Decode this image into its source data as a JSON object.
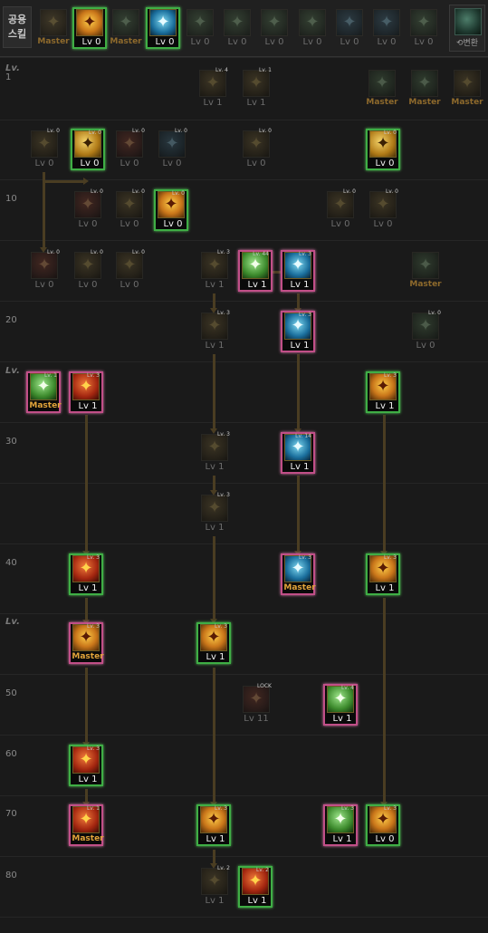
{
  "top_bar": {
    "share_tab_label_1": "공용",
    "share_tab_label_2": "스킬",
    "convert_label": "⟲변환",
    "slots": [
      {
        "name": "crab-claw-icon",
        "label": "Master",
        "state": "dim",
        "theme": "i-dark"
      },
      {
        "name": "gold-flame-icon",
        "label": "Lv 0",
        "state": "active",
        "theme": "i-gold2"
      },
      {
        "name": "wolf-head-icon",
        "label": "Master",
        "state": "dim",
        "theme": "i-darkg"
      },
      {
        "name": "blue-wings-icon",
        "label": "Lv 0",
        "state": "active",
        "theme": "i-blue"
      },
      {
        "name": "green-swirl-icon",
        "label": "Lv 0",
        "state": "dim",
        "theme": "i-darkg"
      },
      {
        "name": "target-icon",
        "label": "Lv 0",
        "state": "dim",
        "theme": "i-darkg"
      },
      {
        "name": "crouching-figure-icon",
        "label": "Lv 0",
        "state": "dim",
        "theme": "i-darkg"
      },
      {
        "name": "dragon-head-icon",
        "label": "Lv 0",
        "state": "dim",
        "theme": "i-darkg"
      },
      {
        "name": "spiral-icon",
        "label": "Lv 0",
        "state": "dim",
        "theme": "i-darkb"
      },
      {
        "name": "armored-figure-icon",
        "label": "Lv 0",
        "state": "dim",
        "theme": "i-darkb"
      },
      {
        "name": "warrior-figure-icon",
        "label": "Lv 0",
        "state": "dim",
        "theme": "i-darkg"
      }
    ]
  },
  "level_labels": [
    {
      "text": "Lv.",
      "kind": "hdr"
    },
    {
      "text": "1",
      "kind": "n"
    },
    {
      "text": "10",
      "kind": "n"
    },
    {
      "text": "20",
      "kind": "n"
    },
    {
      "text": "Lv.",
      "kind": "hdr"
    },
    {
      "text": "30",
      "kind": "n"
    },
    {
      "text": "40",
      "kind": "n"
    },
    {
      "text": "Lv.",
      "kind": "hdr"
    },
    {
      "text": "50",
      "kind": "n"
    },
    {
      "text": "60",
      "kind": "n"
    },
    {
      "text": "70",
      "kind": "n"
    },
    {
      "text": "80",
      "kind": "n"
    }
  ],
  "skills": [
    {
      "id": "shuriken-dash",
      "label": "Lv 1",
      "state": "dim",
      "theme": "i-dark",
      "small": "Lv. 4"
    },
    {
      "id": "axe-strike",
      "label": "Lv 1",
      "state": "dim",
      "theme": "i-dark",
      "small": "Lv. 1"
    },
    {
      "id": "stance-master-a",
      "label": "Master",
      "state": "dim",
      "theme": "i-darkg",
      "small": ""
    },
    {
      "id": "stance-master-b",
      "label": "Master",
      "state": "dim",
      "theme": "i-darkg",
      "small": ""
    },
    {
      "id": "stance-master-c",
      "label": "Master",
      "state": "dim",
      "theme": "i-dark",
      "small": ""
    },
    {
      "id": "fish-throw",
      "label": "Lv 0",
      "state": "dim",
      "theme": "i-dark",
      "small": "Lv. 0"
    },
    {
      "id": "golden-burst",
      "label": "Lv 0",
      "state": "active",
      "theme": "i-gold",
      "small": "Lv. 0"
    },
    {
      "id": "pentagram",
      "label": "Lv 0",
      "state": "dim",
      "theme": "i-darkr",
      "small": "Lv. 0"
    },
    {
      "id": "knot-seal",
      "label": "Lv 0",
      "state": "dim",
      "theme": "i-darkb",
      "small": "Lv. 0"
    },
    {
      "id": "whip-lash",
      "label": "Lv 0",
      "state": "dim",
      "theme": "i-dark",
      "small": "Lv. 0"
    },
    {
      "id": "rising-kick",
      "label": "Lv 0",
      "state": "active",
      "theme": "i-gold",
      "small": "Lv. 0"
    },
    {
      "id": "red-charm",
      "label": "Lv 0",
      "state": "dim",
      "theme": "i-darkr",
      "small": "Lv. 0"
    },
    {
      "id": "flame-wave",
      "label": "Lv 0",
      "state": "dim",
      "theme": "i-dark",
      "small": "Lv. 0"
    },
    {
      "id": "gold-aura",
      "label": "Lv 0",
      "state": "active",
      "theme": "i-gold2",
      "small": "Lv. 0"
    },
    {
      "id": "twin-blades",
      "label": "Lv 0",
      "state": "dim",
      "theme": "i-dark",
      "small": "Lv. 0"
    },
    {
      "id": "sweeping-kick",
      "label": "Lv 0",
      "state": "dim",
      "theme": "i-dark",
      "small": "Lv. 0"
    },
    {
      "id": "crimson-slash",
      "label": "Lv 0",
      "state": "dim",
      "theme": "i-darkr",
      "small": "Lv. 0"
    },
    {
      "id": "spider-burst",
      "label": "Lv 0",
      "state": "dim",
      "theme": "i-dark",
      "small": "Lv. 0"
    },
    {
      "id": "fire-pillar",
      "label": "Lv 0",
      "state": "dim",
      "theme": "i-dark",
      "small": "Lv. 0"
    },
    {
      "id": "wind-cut",
      "label": "Lv 1",
      "state": "dim",
      "theme": "i-dark",
      "small": "Lv. 3"
    },
    {
      "id": "green-leap",
      "label": "Lv 1",
      "state": "pink",
      "theme": "i-green",
      "small": "Lv. 44"
    },
    {
      "id": "water-blade",
      "label": "Lv 1",
      "state": "pink",
      "theme": "i-blue",
      "small": "Lv. 3"
    },
    {
      "id": "forest-master",
      "label": "Master",
      "state": "dim",
      "theme": "i-darkg",
      "small": ""
    },
    {
      "id": "heat-ray",
      "label": "Lv 1",
      "state": "dim",
      "theme": "i-dark",
      "small": "Lv. 3"
    },
    {
      "id": "heart-shield",
      "label": "Lv 1",
      "state": "pink",
      "theme": "i-blue",
      "small": "Lv. 3"
    },
    {
      "id": "shadow-step",
      "label": "Lv 0",
      "state": "dim",
      "theme": "i-darkg",
      "small": "Lv. 0"
    },
    {
      "id": "spirit-call",
      "label": "Master",
      "state": "pink",
      "theme": "i-green",
      "small": "Lv. 1"
    },
    {
      "id": "flame-claw",
      "label": "Lv 1",
      "state": "pink",
      "theme": "i-red",
      "small": "Lv. 3"
    },
    {
      "id": "shift-roar",
      "label": "Lv 1",
      "state": "active",
      "theme": "i-gold2",
      "small": "Lv. 3"
    },
    {
      "id": "tiger-fang",
      "label": "Lv 1",
      "state": "dim",
      "theme": "i-dark",
      "small": "Lv. 3"
    },
    {
      "id": "tidal-wave",
      "label": "Lv 1",
      "state": "pink",
      "theme": "i-blue",
      "small": "Lv. 14"
    },
    {
      "id": "explosion",
      "label": "Lv 1",
      "state": "dim",
      "theme": "i-dark",
      "small": "Lv. 3"
    },
    {
      "id": "inferno-fist",
      "label": "Lv 1",
      "state": "active",
      "theme": "i-red",
      "small": "Lv. 3"
    },
    {
      "id": "aqua-heal",
      "label": "Master",
      "state": "pink",
      "theme": "i-blue",
      "small": "Lv. 3"
    },
    {
      "id": "beast-howl",
      "label": "Lv 1",
      "state": "active",
      "theme": "i-gold2",
      "small": "Lv. 3"
    },
    {
      "id": "golden-lion",
      "label": "Master",
      "state": "pink",
      "theme": "i-gold2",
      "small": "Lv. 3"
    },
    {
      "id": "sun-burst",
      "label": "Lv 1",
      "state": "active",
      "theme": "i-gold2",
      "small": "Lv. 3"
    },
    {
      "id": "red-seal",
      "label": "Lv 11",
      "state": "dim",
      "theme": "i-darkr",
      "small": "LOCK"
    },
    {
      "id": "jade-serpent",
      "label": "Lv 1",
      "state": "pink",
      "theme": "i-green",
      "small": "Lv. 4"
    },
    {
      "id": "blaze-rush",
      "label": "Lv 1",
      "state": "active",
      "theme": "i-red",
      "small": "Lv. 3"
    },
    {
      "id": "awakening-flame",
      "label": "Master",
      "state": "pink",
      "theme": "i-red",
      "small": "Lv. 1"
    },
    {
      "id": "solar-crown",
      "label": "Lv 1",
      "state": "active",
      "theme": "i-gold2",
      "small": "Lv. 3"
    },
    {
      "id": "emerald-coil",
      "label": "Lv 1",
      "state": "pink",
      "theme": "i-green",
      "small": "Lv. 3"
    },
    {
      "id": "golden-mask",
      "label": "Lv 0",
      "state": "active",
      "theme": "i-gold2",
      "small": "Lv. 3"
    },
    {
      "id": "dusk-blade",
      "label": "Lv 1",
      "state": "dim",
      "theme": "i-dark",
      "small": "Lv. 2"
    },
    {
      "id": "phoenix-ultimate",
      "label": "Lv 1",
      "state": "active",
      "theme": "i-red",
      "small": "Lv. 2"
    }
  ]
}
